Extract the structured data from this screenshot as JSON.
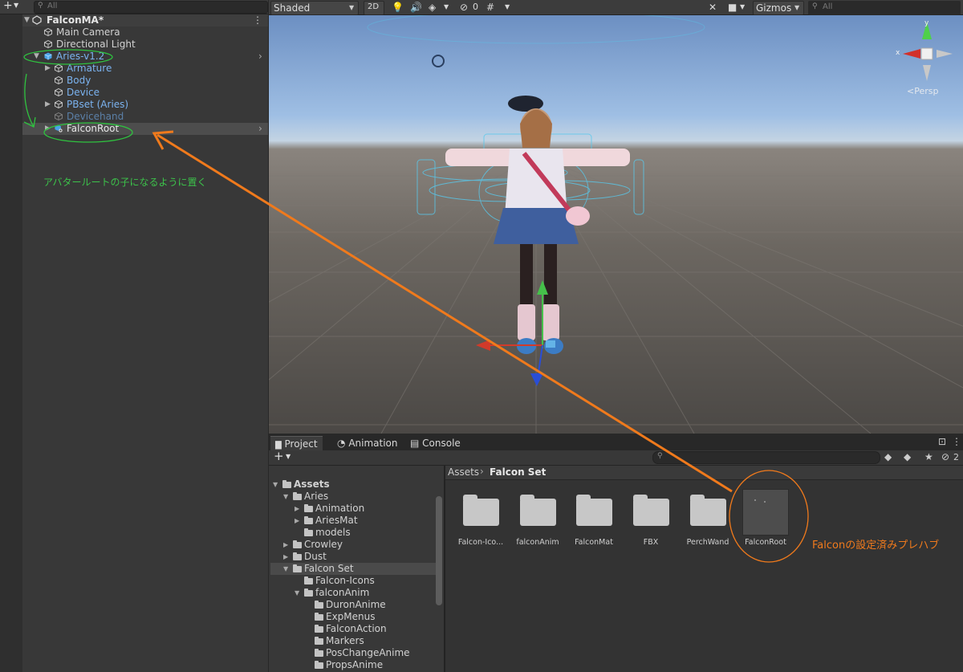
{
  "hierarchy": {
    "search_placeholder": "All",
    "scene_name": "FalconMA*",
    "items": [
      {
        "label": "Main Camera"
      },
      {
        "label": "Directional Light"
      },
      {
        "label": "Aries-v1.2"
      },
      {
        "label": "Armature"
      },
      {
        "label": "Body"
      },
      {
        "label": "Device"
      },
      {
        "label": "PBset (Aries)"
      },
      {
        "label": "Devicehand"
      },
      {
        "label": "FalconRoot"
      }
    ]
  },
  "scene_toolbar": {
    "shading_mode": "Shaded",
    "mode_2d": "2D",
    "hidden_count": "0",
    "gizmos_label": "Gizmos",
    "search_placeholder": "All"
  },
  "viewport": {
    "persp_label": "<Persp",
    "axis_y": "y",
    "axis_x": "x"
  },
  "project": {
    "tabs": [
      {
        "label": "Project"
      },
      {
        "label": "Animation"
      },
      {
        "label": "Console"
      }
    ],
    "hidden_count": "2",
    "tree": [
      {
        "label": "Assets"
      },
      {
        "label": "Aries"
      },
      {
        "label": "Animation"
      },
      {
        "label": "AriesMat"
      },
      {
        "label": "models"
      },
      {
        "label": "Crowley"
      },
      {
        "label": "Dust"
      },
      {
        "label": "Falcon Set"
      },
      {
        "label": "Falcon-Icons"
      },
      {
        "label": "falconAnim"
      },
      {
        "label": "DuronAnime"
      },
      {
        "label": "ExpMenus"
      },
      {
        "label": "FalconAction"
      },
      {
        "label": "Markers"
      },
      {
        "label": "PosChangeAnime"
      },
      {
        "label": "PropsAnime"
      }
    ],
    "breadcrumb": {
      "root": "Assets",
      "current": "Falcon Set"
    },
    "assets": [
      {
        "label": "Falcon-Ico..."
      },
      {
        "label": "falconAnim"
      },
      {
        "label": "FalconMat"
      },
      {
        "label": "FBX"
      },
      {
        "label": "PerchWand"
      },
      {
        "label": "FalconRoot"
      }
    ]
  },
  "annotations": {
    "green_note": "アバタールートの子になるように置く",
    "orange_note": "Falconの設定済みプレハブ"
  },
  "colors": {
    "annotation_green": "#3cc24a",
    "annotation_orange": "#f07a1c",
    "selected_row": "#4d4d4d",
    "unity_blue": "#7bb3f0"
  }
}
